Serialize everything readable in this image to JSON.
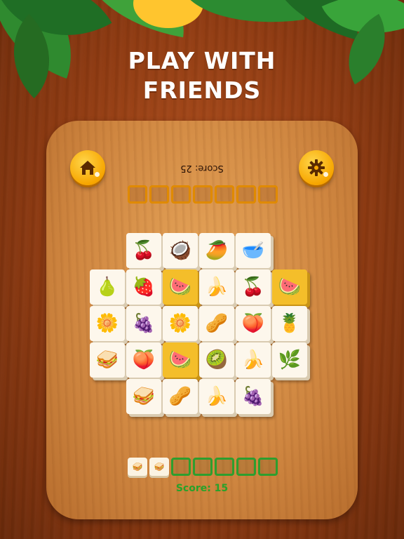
{
  "headline": {
    "line1": "PLAY WITH",
    "line2": "FRIENDS"
  },
  "opponent": {
    "score_label": "Score: 25",
    "slots": 7
  },
  "player": {
    "score_label": "Score: 15",
    "slots": 7,
    "filled_slots": [
      {
        "icon": "sandwich-icon",
        "glyph": "🥪"
      },
      {
        "icon": "sandwich-icon",
        "glyph": "🥪"
      }
    ]
  },
  "buttons": {
    "home": "home-icon",
    "settings": "gear-icon"
  },
  "tiles": [
    {
      "name": "tile-cherries",
      "glyph": "🍒",
      "highlight": false
    },
    {
      "name": "tile-coconut",
      "glyph": "🥥",
      "highlight": false
    },
    {
      "name": "tile-mango",
      "glyph": "🥭",
      "highlight": false
    },
    {
      "name": "tile-cereal",
      "glyph": "🥣",
      "highlight": false
    },
    {
      "name": "tile-papaya",
      "glyph": "🍐",
      "highlight": false
    },
    {
      "name": "tile-strawberry",
      "glyph": "🍓",
      "highlight": false
    },
    {
      "name": "tile-watermelon",
      "glyph": "🍉",
      "highlight": true
    },
    {
      "name": "tile-banana",
      "glyph": "🍌",
      "highlight": false
    },
    {
      "name": "tile-cherries",
      "glyph": "🍒",
      "highlight": false
    },
    {
      "name": "tile-watermelon",
      "glyph": "🍉",
      "highlight": true
    },
    {
      "name": "tile-flower-cookie",
      "glyph": "🌼",
      "highlight": false
    },
    {
      "name": "tile-berries",
      "glyph": "🍇",
      "highlight": false
    },
    {
      "name": "tile-flower-cookie",
      "glyph": "🌼",
      "highlight": false
    },
    {
      "name": "tile-almonds",
      "glyph": "🥜",
      "highlight": false
    },
    {
      "name": "tile-peach",
      "glyph": "🍑",
      "highlight": false
    },
    {
      "name": "tile-pineapple",
      "glyph": "🍍",
      "highlight": false
    },
    {
      "name": "tile-sandwich",
      "glyph": "🥪",
      "highlight": false
    },
    {
      "name": "tile-peach",
      "glyph": "🍑",
      "highlight": false
    },
    {
      "name": "tile-watermelon",
      "glyph": "🍉",
      "highlight": true
    },
    {
      "name": "tile-kiwi",
      "glyph": "🥝",
      "highlight": false
    },
    {
      "name": "tile-banana",
      "glyph": "🍌",
      "highlight": false
    },
    {
      "name": "tile-herb",
      "glyph": "🌿",
      "highlight": false
    },
    {
      "name": "tile-sandwich",
      "glyph": "🥪",
      "highlight": false
    },
    {
      "name": "tile-almonds",
      "glyph": "🥜",
      "highlight": false
    },
    {
      "name": "tile-banana",
      "glyph": "🍌",
      "highlight": false
    },
    {
      "name": "tile-berries",
      "glyph": "🍇",
      "highlight": false
    }
  ],
  "colors": {
    "accent": "#f7a600",
    "player": "#27a22a",
    "opponent_slot": "#e08a00"
  }
}
